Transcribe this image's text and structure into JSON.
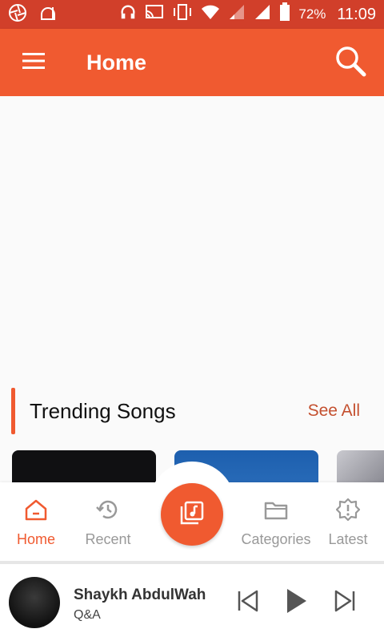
{
  "status_bar": {
    "battery": "72%",
    "time": "11:09",
    "icons": [
      "camera-shutter-icon",
      "mosque-icon",
      "headphones-icon",
      "cast-icon",
      "vibrate-icon",
      "wifi-icon",
      "signal-icon",
      "signal-icon",
      "battery-icon"
    ]
  },
  "app_bar": {
    "title": "Home",
    "menu_icon": "hamburger-menu-icon",
    "search_icon": "search-icon"
  },
  "section": {
    "title": "Trending Songs",
    "see_all": "See All"
  },
  "bottom_nav": {
    "items": [
      {
        "label": "Home",
        "icon": "home-icon",
        "active": true
      },
      {
        "label": "Recent",
        "icon": "history-icon",
        "active": false
      },
      {
        "label": "Categories",
        "icon": "folder-icon",
        "active": false
      },
      {
        "label": "Latest",
        "icon": "badge-alert-icon",
        "active": false
      }
    ],
    "center_icon": "music-library-icon"
  },
  "player": {
    "title": "Shaykh AbdulWah",
    "subtitle": "Q&A",
    "controls": [
      "skip-previous-icon",
      "play-icon",
      "skip-next-icon"
    ]
  },
  "colors": {
    "status_bar": "#d13f2a",
    "accent": "#f05a30",
    "see_all": "#c4502f"
  }
}
